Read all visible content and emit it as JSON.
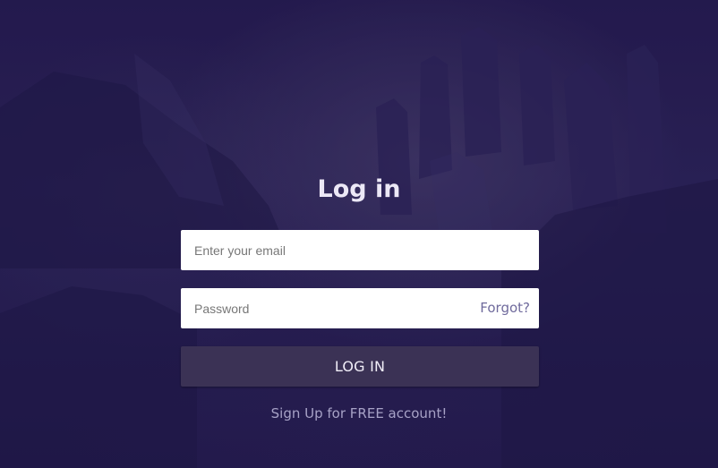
{
  "title": "Log in",
  "email": {
    "placeholder": "Enter your email",
    "value": ""
  },
  "password": {
    "placeholder": "Password",
    "value": "",
    "forgot_label": "Forgot?"
  },
  "login_button": "LOG IN",
  "signup_link": "Sign Up for FREE account!",
  "colors": {
    "background": "#201848",
    "button": "#3b3255",
    "forgot_link": "#6f6a9c",
    "signup_link": "#a7a2c6"
  }
}
